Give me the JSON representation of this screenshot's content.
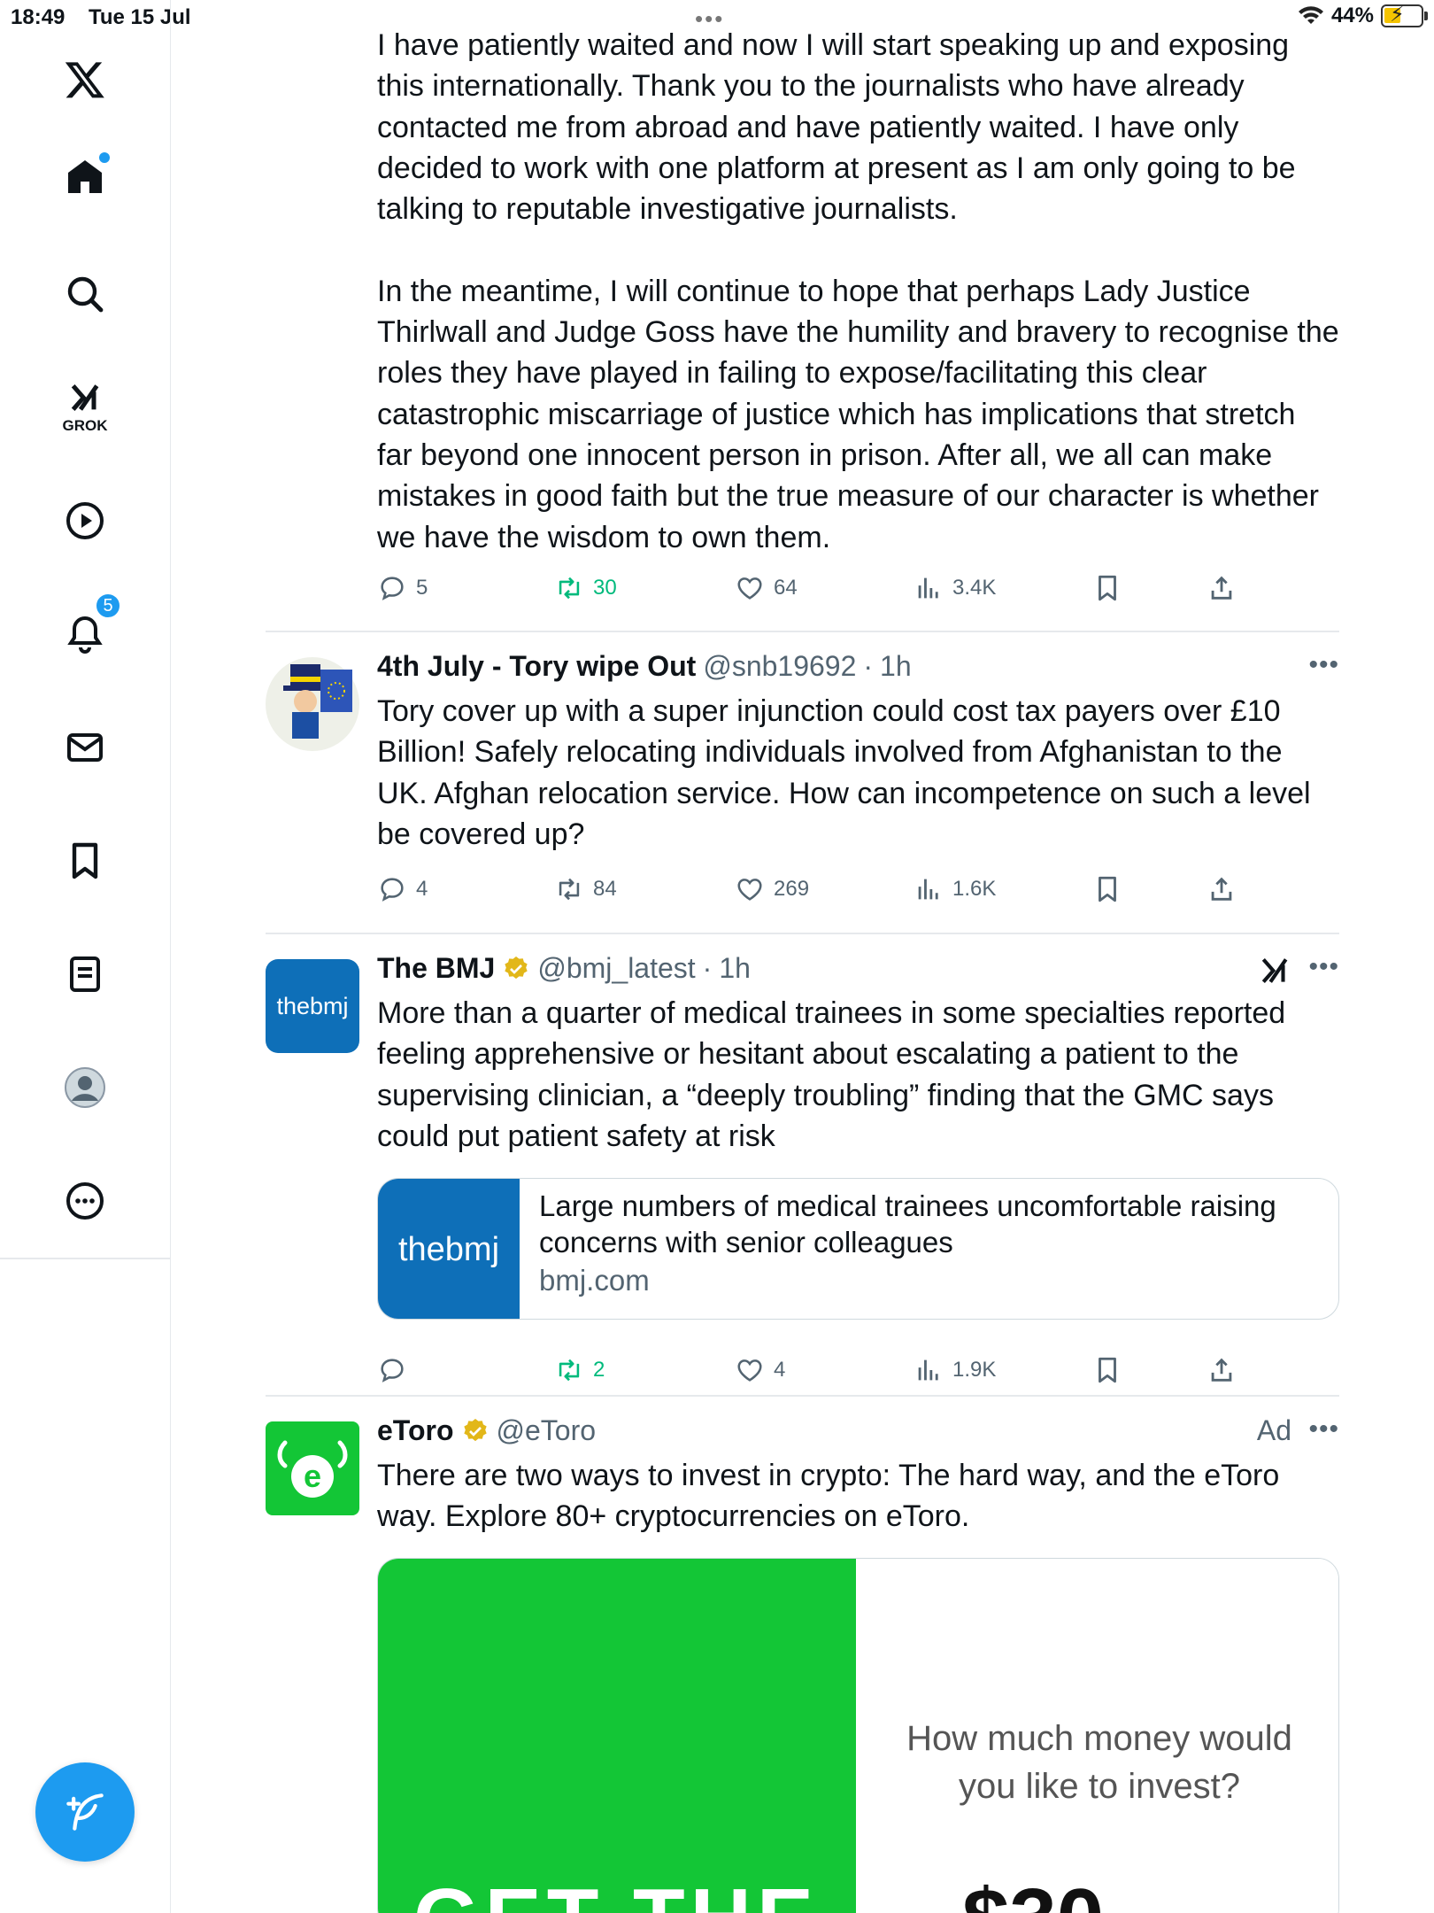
{
  "status_bar": {
    "time": "18:49",
    "date": "Tue 15 Jul",
    "battery": "44%"
  },
  "sidebar": {
    "grok_label": "GROK",
    "notifications_badge": "5"
  },
  "continued_post": {
    "text": "I have patiently waited and now I will start speaking up and exposing\nthis internationally. Thank you to the journalists who have already\ncontacted me from abroad and have patiently waited. I have only\ndecided to work with one platform at present as I am only going to be\ntalking to reputable investigative journalists.\n\nIn the meantime, I will continue to hope that perhaps Lady Justice\nThirlwall and Judge Goss have the humility and bravery to recognise the\nroles they have played in failing to expose/facilitating this clear\ncatastrophic miscarriage of justice which has implications that stretch\nfar beyond one innocent person in prison. After all, we all can make\nmistakes in good faith but the true measure of our character is whether\nwe have the wisdom to own them.",
    "replies": "5",
    "reposts": "30",
    "likes": "64",
    "views": "3.4K"
  },
  "post_tory": {
    "name": "4th July - Tory wipe Out",
    "handle": "@snb19692",
    "time": "1h",
    "text": "Tory cover up with a super injunction could cost tax payers over £10\nBillion! Safely relocating individuals involved from Afghanistan to the\nUK. Afghan relocation service. How can incompetence on such a level\nbe covered up?",
    "replies": "4",
    "reposts": "84",
    "likes": "269",
    "views": "1.6K"
  },
  "post_bmj": {
    "name": "The BMJ",
    "handle": "@bmj_latest",
    "time": "1h",
    "avatar_text": "thebmj",
    "text": "More than a quarter of medical trainees in some specialties reported\nfeeling apprehensive or hesitant about escalating a patient to the\nsupervising clinician, a “deeply troubling” finding that the GMC says\ncould put patient safety at risk",
    "card_title": "Large numbers of medical trainees uncomfortable raising concerns with senior colleagues",
    "card_domain": "bmj.com",
    "card_thumb_text": "thebmj",
    "replies": "",
    "reposts": "2",
    "likes": "4",
    "views": "1.9K"
  },
  "post_etoro": {
    "name": "eToro",
    "handle": "@eToro",
    "ad_label": "Ad",
    "text": "There are two ways to invest in crypto: The hard way, and the eToro\nway. Explore 80+ cryptocurrencies on eToro.",
    "ad_question": "How much money would you like to invest?",
    "ad_big_left": "GET THE",
    "ad_big_right": "$30"
  },
  "colors": {
    "accent": "#1d9bf0",
    "repost_green": "#00ba7c",
    "bmj_blue": "#0e6fb8",
    "etoro_green": "#13c636"
  },
  "icons": [
    "x-logo-icon",
    "home-icon",
    "search-icon",
    "grok-icon",
    "video-icon",
    "bell-icon",
    "mail-icon",
    "bookmark-icon",
    "list-icon",
    "profile-icon",
    "more-circle-icon",
    "compose-icon",
    "reply-icon",
    "repost-icon",
    "like-icon",
    "views-icon",
    "bookmark-icon",
    "share-icon",
    "verified-icon",
    "grok-explain-icon"
  ]
}
